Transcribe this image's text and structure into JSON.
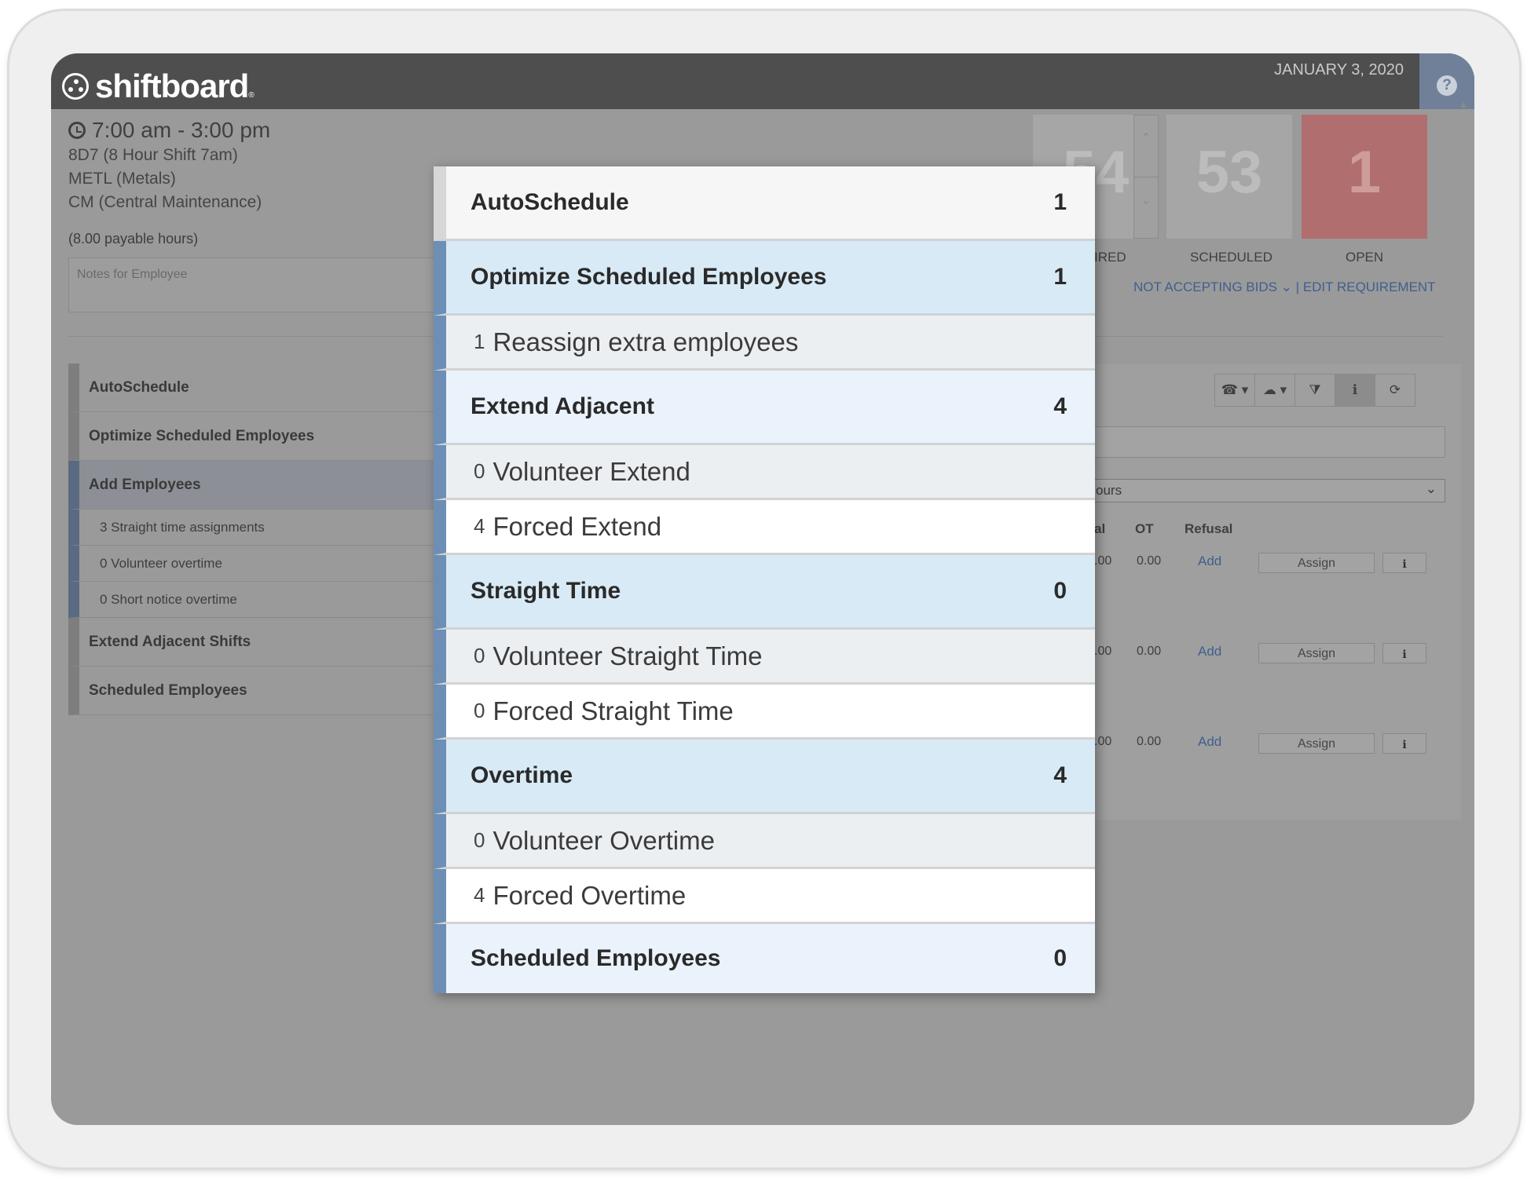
{
  "app": {
    "logo": "shiftboard",
    "logo_reg": "®",
    "date": "JANUARY 3, 2020",
    "help": "?"
  },
  "shift": {
    "time": "7:00 am - 3:00 pm",
    "lines": [
      "8D7 (8 Hour Shift 7am)",
      "METL (Metals)",
      "CM (Central Maintenance)"
    ],
    "payable": "(8.00 payable hours)",
    "notes_placeholder": "Notes for Employee"
  },
  "leftnav": {
    "autoschedule": "AutoSchedule",
    "optimize": "Optimize Scheduled Employees",
    "add": "Add Employees",
    "add_subs": [
      "3 Straight time assignments",
      "0 Volunteer overtime",
      "0 Short notice overtime"
    ],
    "extend": "Extend Adjacent Shifts",
    "scheduled": "Scheduled Employees"
  },
  "stats": {
    "required_value": "54",
    "required_label": "IRED",
    "scheduled_value": "53",
    "scheduled_label": "SCHEDULED",
    "open_value": "1",
    "open_label": "OPEN",
    "spin_up": "⌃",
    "spin_down": "⌄"
  },
  "links": {
    "bids": "NOT ACCEPTING BIDS ⌄",
    "sep": "|",
    "edit": "EDIT REQUIREMENT"
  },
  "toolbar": {
    "phone": "☎ ▾",
    "cloud": "☁ ▾",
    "filter": "⧩",
    "info": "ℹ",
    "refresh": "⟳"
  },
  "filter": {
    "select_value": "ours",
    "select_arrow": "⌄"
  },
  "table": {
    "headers": {
      "reg": "al",
      "ot": "OT",
      "refusal": "Refusal"
    },
    "rows": [
      {
        "reg": ".00",
        "ot": "0.00",
        "add": "Add",
        "assign": "Assign",
        "info": "ℹ"
      },
      {
        "reg": ".00",
        "ot": "0.00",
        "add": "Add",
        "assign": "Assign",
        "info": "ℹ"
      },
      {
        "reg": ".00",
        "ot": "0.00",
        "add": "Add",
        "assign": "Assign",
        "info": "ℹ"
      }
    ]
  },
  "modal": {
    "autoschedule": {
      "label": "AutoSchedule",
      "count": "1"
    },
    "optimize": {
      "label": "Optimize Scheduled Employees",
      "count": "1"
    },
    "reassign": {
      "count": "1",
      "label": "Reassign extra employees"
    },
    "extend": {
      "label": "Extend Adjacent",
      "count": "4"
    },
    "volunteer_extend": {
      "count": "0",
      "label": "Volunteer Extend"
    },
    "forced_extend": {
      "count": "4",
      "label": "Forced Extend"
    },
    "straight": {
      "label": "Straight Time",
      "count": "0"
    },
    "volunteer_straight": {
      "count": "0",
      "label": "Volunteer Straight Time"
    },
    "forced_straight": {
      "count": "0",
      "label": "Forced Straight Time"
    },
    "overtime": {
      "label": "Overtime",
      "count": "4"
    },
    "volunteer_overtime": {
      "count": "0",
      "label": "Volunteer Overtime"
    },
    "forced_overtime": {
      "count": "4",
      "label": "Forced Overtime"
    },
    "scheduled": {
      "label": "Scheduled Employees",
      "count": "0"
    }
  },
  "colors": {
    "accent": "#6d8fb5",
    "open": "#b16e6e",
    "highlight": "#d8eaf5"
  }
}
